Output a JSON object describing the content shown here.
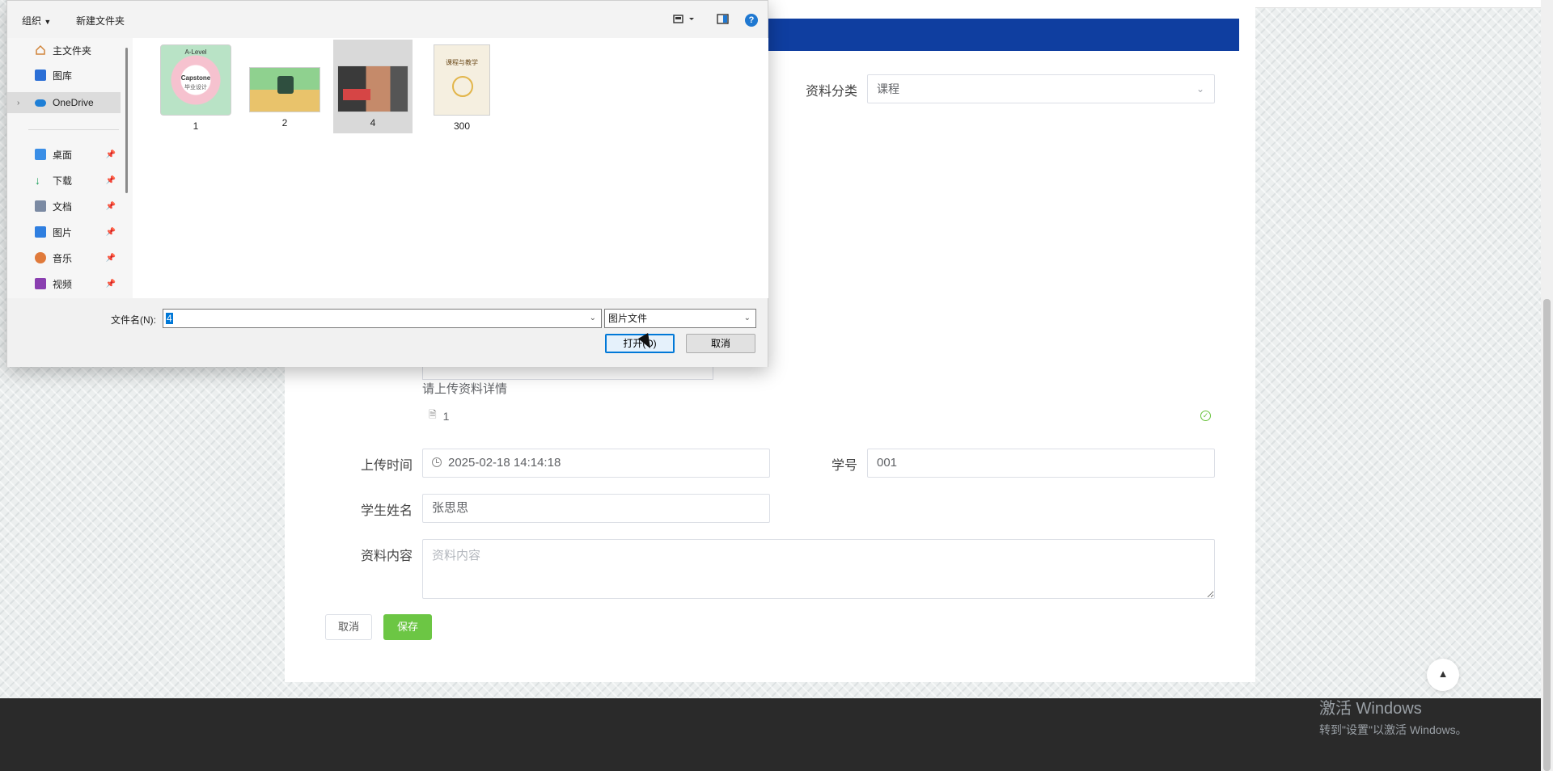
{
  "form": {
    "category_label": "资料分类",
    "category_value": "课程",
    "upload_hint": "请上传资料详情",
    "uploaded_file_name": "1",
    "upload_time_label": "上传时间",
    "upload_time_value": "2025-02-18 14:14:18",
    "student_id_label": "学号",
    "student_id_value": "001",
    "student_name_label": "学生姓名",
    "student_name_value": "张思思",
    "content_label": "资料内容",
    "content_placeholder": "资料内容",
    "cancel_label": "取消",
    "save_label": "保存"
  },
  "file_dialog": {
    "toolbar": {
      "organize_label": "组织",
      "new_folder_label": "新建文件夹"
    },
    "nav_items": [
      {
        "label": "主文件夹",
        "icon": "home-icon"
      },
      {
        "label": "图库",
        "icon": "gallery-icon"
      },
      {
        "label": "OneDrive",
        "icon": "cloud-icon"
      },
      {
        "label": "桌面",
        "icon": "desktop-icon"
      },
      {
        "label": "下载",
        "icon": "download-icon"
      },
      {
        "label": "文档",
        "icon": "document-icon"
      },
      {
        "label": "图片",
        "icon": "pictures-icon"
      },
      {
        "label": "音乐",
        "icon": "music-icon"
      },
      {
        "label": "视频",
        "icon": "video-icon"
      }
    ],
    "files": [
      {
        "name": "1",
        "thumb_text_top": "A-Level",
        "thumb_text_center": "Capstone",
        "thumb_text_sub": "毕业设计"
      },
      {
        "name": "2"
      },
      {
        "name": "4"
      },
      {
        "name": "300",
        "thumb_text_center": "课程与教学"
      }
    ],
    "filename_label": "文件名(N):",
    "filename_value": "4",
    "filetype_value": "图片文件",
    "open_label": "打开(O)",
    "cancel_label": "取消"
  },
  "windows_watermark": {
    "line1": "激活 Windows",
    "line2": "转到\"设置\"以激活 Windows。"
  },
  "colors": {
    "header_blue": "#0f3ea0",
    "save_green": "#6cc644",
    "selection_blue": "#0078d7"
  }
}
